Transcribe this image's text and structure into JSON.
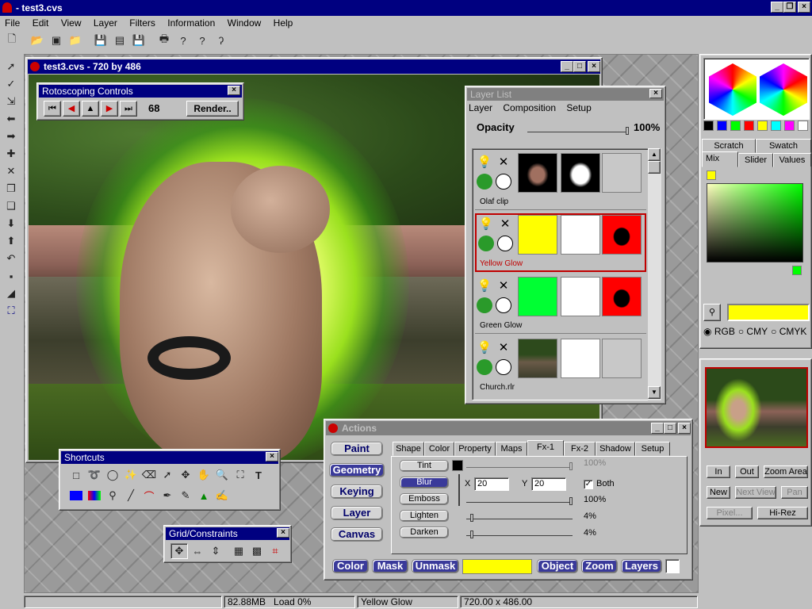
{
  "app": {
    "title": "- test3.cvs",
    "controls": {
      "min": "_",
      "max": "❐",
      "close": "×"
    }
  },
  "menu": [
    "File",
    "Edit",
    "View",
    "Layer",
    "Filters",
    "Information",
    "Window",
    "Help"
  ],
  "doc": {
    "title": "test3.cvs - 720 by 486"
  },
  "roto": {
    "title": "Rotoscoping Controls",
    "frame": "68",
    "render": "Render.."
  },
  "layers": {
    "title": "Layer List",
    "menu": [
      "Layer",
      "Composition",
      "Setup"
    ],
    "opacity_label": "Opacity",
    "opacity_value": "100%",
    "opacity_level": 1.0,
    "items": [
      {
        "name": "Olaf clip",
        "selected": false
      },
      {
        "name": "Yellow Glow",
        "selected": true
      },
      {
        "name": "Green Glow",
        "selected": false
      },
      {
        "name": "Church.rlr",
        "selected": false
      }
    ]
  },
  "shortcuts": {
    "title": "Shortcuts"
  },
  "grid": {
    "title": "Grid/Constraints"
  },
  "actions": {
    "title": "Actions",
    "side": [
      "Paint",
      "Geometry",
      "Keying",
      "Layer",
      "Canvas"
    ],
    "tabs": [
      "Shape",
      "Color",
      "Property",
      "Maps",
      "Fx-1",
      "Fx-2",
      "Shadow",
      "Setup"
    ],
    "fx": [
      "Tint",
      "Blur",
      "Emboss",
      "Lighten",
      "Darken"
    ],
    "tint_value": "100%",
    "x_label": "X",
    "x_value": "20",
    "y_label": "Y",
    "y_value": "20",
    "both_label": "Both",
    "emboss_value": "100%",
    "lighten_value": "4%",
    "darken_value": "4%",
    "bottom": [
      "Color",
      "Mask",
      "Unmask",
      "Object",
      "Zoom",
      "Layers"
    ],
    "swatch_color": "#ffff00"
  },
  "colorpanel": {
    "palette": [
      "#000000",
      "#0000ff",
      "#00ff00",
      "#ff0000",
      "#ffff00",
      "#00ffff",
      "#ff00ff",
      "#ffffff"
    ],
    "tabs_top": [
      "Scratch",
      "Swatch"
    ],
    "tabs": [
      "Mix",
      "Slider",
      "Values"
    ],
    "current": "#ffff00",
    "models": [
      "RGB",
      "CMY",
      "CMYK"
    ]
  },
  "nav": {
    "buttons": [
      "In",
      "Out",
      "Zoom Area",
      "New",
      "Next View",
      "Pan",
      "Pixel...",
      "Hi-Rez"
    ]
  },
  "status": {
    "mem": "82.88MB",
    "load": "Load 0%",
    "layer": "Yellow Glow",
    "size": "720.00 x 486.00"
  }
}
